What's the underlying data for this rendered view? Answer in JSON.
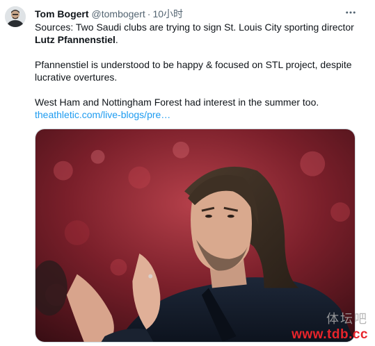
{
  "tweet": {
    "author": {
      "display_name": "Tom Bogert",
      "handle": "@tombogert",
      "separator": "·",
      "time": "10小时",
      "avatar_icon": "user-avatar"
    },
    "more_icon": "more-dots-icon",
    "text": {
      "line1_prefix": "Sources: Two Saudi clubs are trying to sign St. Louis City sporting director",
      "line1_bold": "Lutz Pfannenstiel",
      "line1_suffix": ".",
      "para2": "Pfannenstiel is understood to be happy & focused on STL project, despite lucrative overtures.",
      "para3": "West Ham and Nottingham Forest had interest in the summer too.",
      "link": "theathletic.com/live-blogs/pre…"
    },
    "media": {
      "kind": "photo"
    }
  },
  "watermark": {
    "top": "体坛吧",
    "url": "www.tdb.cc"
  },
  "colors": {
    "link": "#1d9bf0",
    "text": "#0f1419",
    "secondary": "#536471",
    "watermark_red": "#e8242b"
  }
}
